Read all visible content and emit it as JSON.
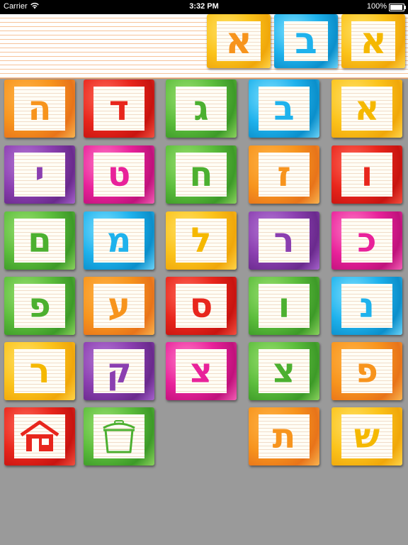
{
  "status_bar": {
    "carrier": "Carrier",
    "time": "3:32 PM",
    "battery": "100%"
  },
  "word": {
    "letters": [
      {
        "letter": "א",
        "tile_color": "yellow",
        "text_color": "orange"
      },
      {
        "letter": "ב",
        "tile_color": "blue",
        "text_color": "blue"
      },
      {
        "letter": "א",
        "tile_color": "yellow",
        "text_color": "yellow"
      }
    ]
  },
  "alphabet": [
    {
      "letter": "א",
      "tile_color": "yellow",
      "text_color": "yellow"
    },
    {
      "letter": "ב",
      "tile_color": "blue",
      "text_color": "blue"
    },
    {
      "letter": "ג",
      "tile_color": "green",
      "text_color": "green"
    },
    {
      "letter": "ד",
      "tile_color": "red",
      "text_color": "red"
    },
    {
      "letter": "ה",
      "tile_color": "orange",
      "text_color": "orange"
    },
    {
      "letter": "ו",
      "tile_color": "red",
      "text_color": "red"
    },
    {
      "letter": "ז",
      "tile_color": "orange",
      "text_color": "orange"
    },
    {
      "letter": "ח",
      "tile_color": "green",
      "text_color": "green"
    },
    {
      "letter": "ט",
      "tile_color": "pink",
      "text_color": "pink"
    },
    {
      "letter": "י",
      "tile_color": "purple",
      "text_color": "purple"
    },
    {
      "letter": "כ",
      "tile_color": "pink",
      "text_color": "pink"
    },
    {
      "letter": "ר",
      "tile_color": "purple",
      "text_color": "purple"
    },
    {
      "letter": "ל",
      "tile_color": "yellow",
      "text_color": "yellow"
    },
    {
      "letter": "מ",
      "tile_color": "blue",
      "text_color": "blue"
    },
    {
      "letter": "ם",
      "tile_color": "green",
      "text_color": "green"
    },
    {
      "letter": "נ",
      "tile_color": "blue",
      "text_color": "blue"
    },
    {
      "letter": "ו",
      "tile_color": "green",
      "text_color": "green"
    },
    {
      "letter": "ס",
      "tile_color": "red",
      "text_color": "red"
    },
    {
      "letter": "ע",
      "tile_color": "orange",
      "text_color": "orange"
    },
    {
      "letter": "פ",
      "tile_color": "green",
      "text_color": "green"
    },
    {
      "letter": "פ",
      "tile_color": "orange",
      "text_color": "orange"
    },
    {
      "letter": "צ",
      "tile_color": "green",
      "text_color": "green"
    },
    {
      "letter": "צ",
      "tile_color": "pink",
      "text_color": "pink"
    },
    {
      "letter": "ק",
      "tile_color": "purple",
      "text_color": "purple"
    },
    {
      "letter": "ר",
      "tile_color": "yellow",
      "text_color": "yellow"
    },
    {
      "letter": "ש",
      "tile_color": "yellow",
      "text_color": "yellow"
    },
    {
      "letter": "ת",
      "tile_color": "orange",
      "text_color": "orange"
    }
  ],
  "controls": {
    "home": {
      "icon": "home-icon",
      "tile_color": "red",
      "icon_color": "#e8261c"
    },
    "trash": {
      "icon": "trash-pot-icon",
      "tile_color": "green",
      "icon_color": "#4cb030"
    }
  },
  "colors": {
    "background": "#9a9a9a",
    "strip_line": "#f6c39a"
  }
}
